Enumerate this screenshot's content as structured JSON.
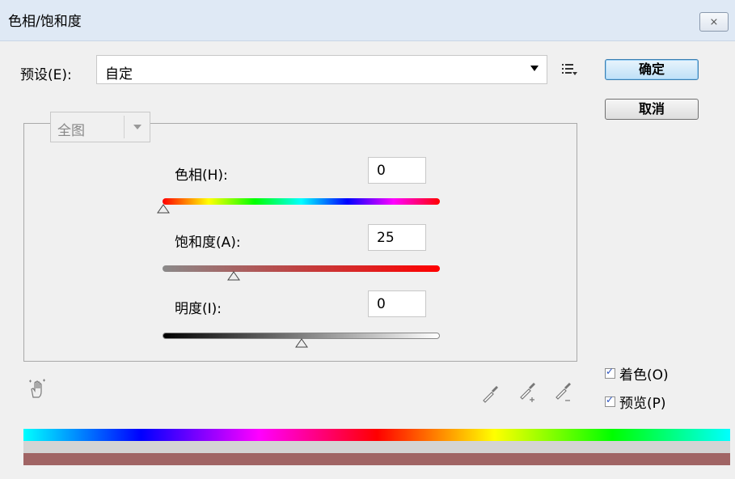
{
  "window": {
    "title": "色相/饱和度",
    "close_label": "⨯"
  },
  "preset": {
    "label": "预设(E):",
    "value": "自定"
  },
  "buttons": {
    "ok": "确定",
    "cancel": "取消"
  },
  "range": {
    "value": "全图"
  },
  "sliders": [
    {
      "label": "色相(H):",
      "value": "0"
    },
    {
      "label": "饱和度(A):",
      "value": "25"
    },
    {
      "label": "明度(I):",
      "value": "0"
    }
  ],
  "options": {
    "colorize": "着色(O)",
    "preview": "预览(P)",
    "colorize_checked": true,
    "preview_checked": true
  },
  "colors": {
    "accent": "#3c7fb1",
    "bottom_tint": "#a06464"
  }
}
